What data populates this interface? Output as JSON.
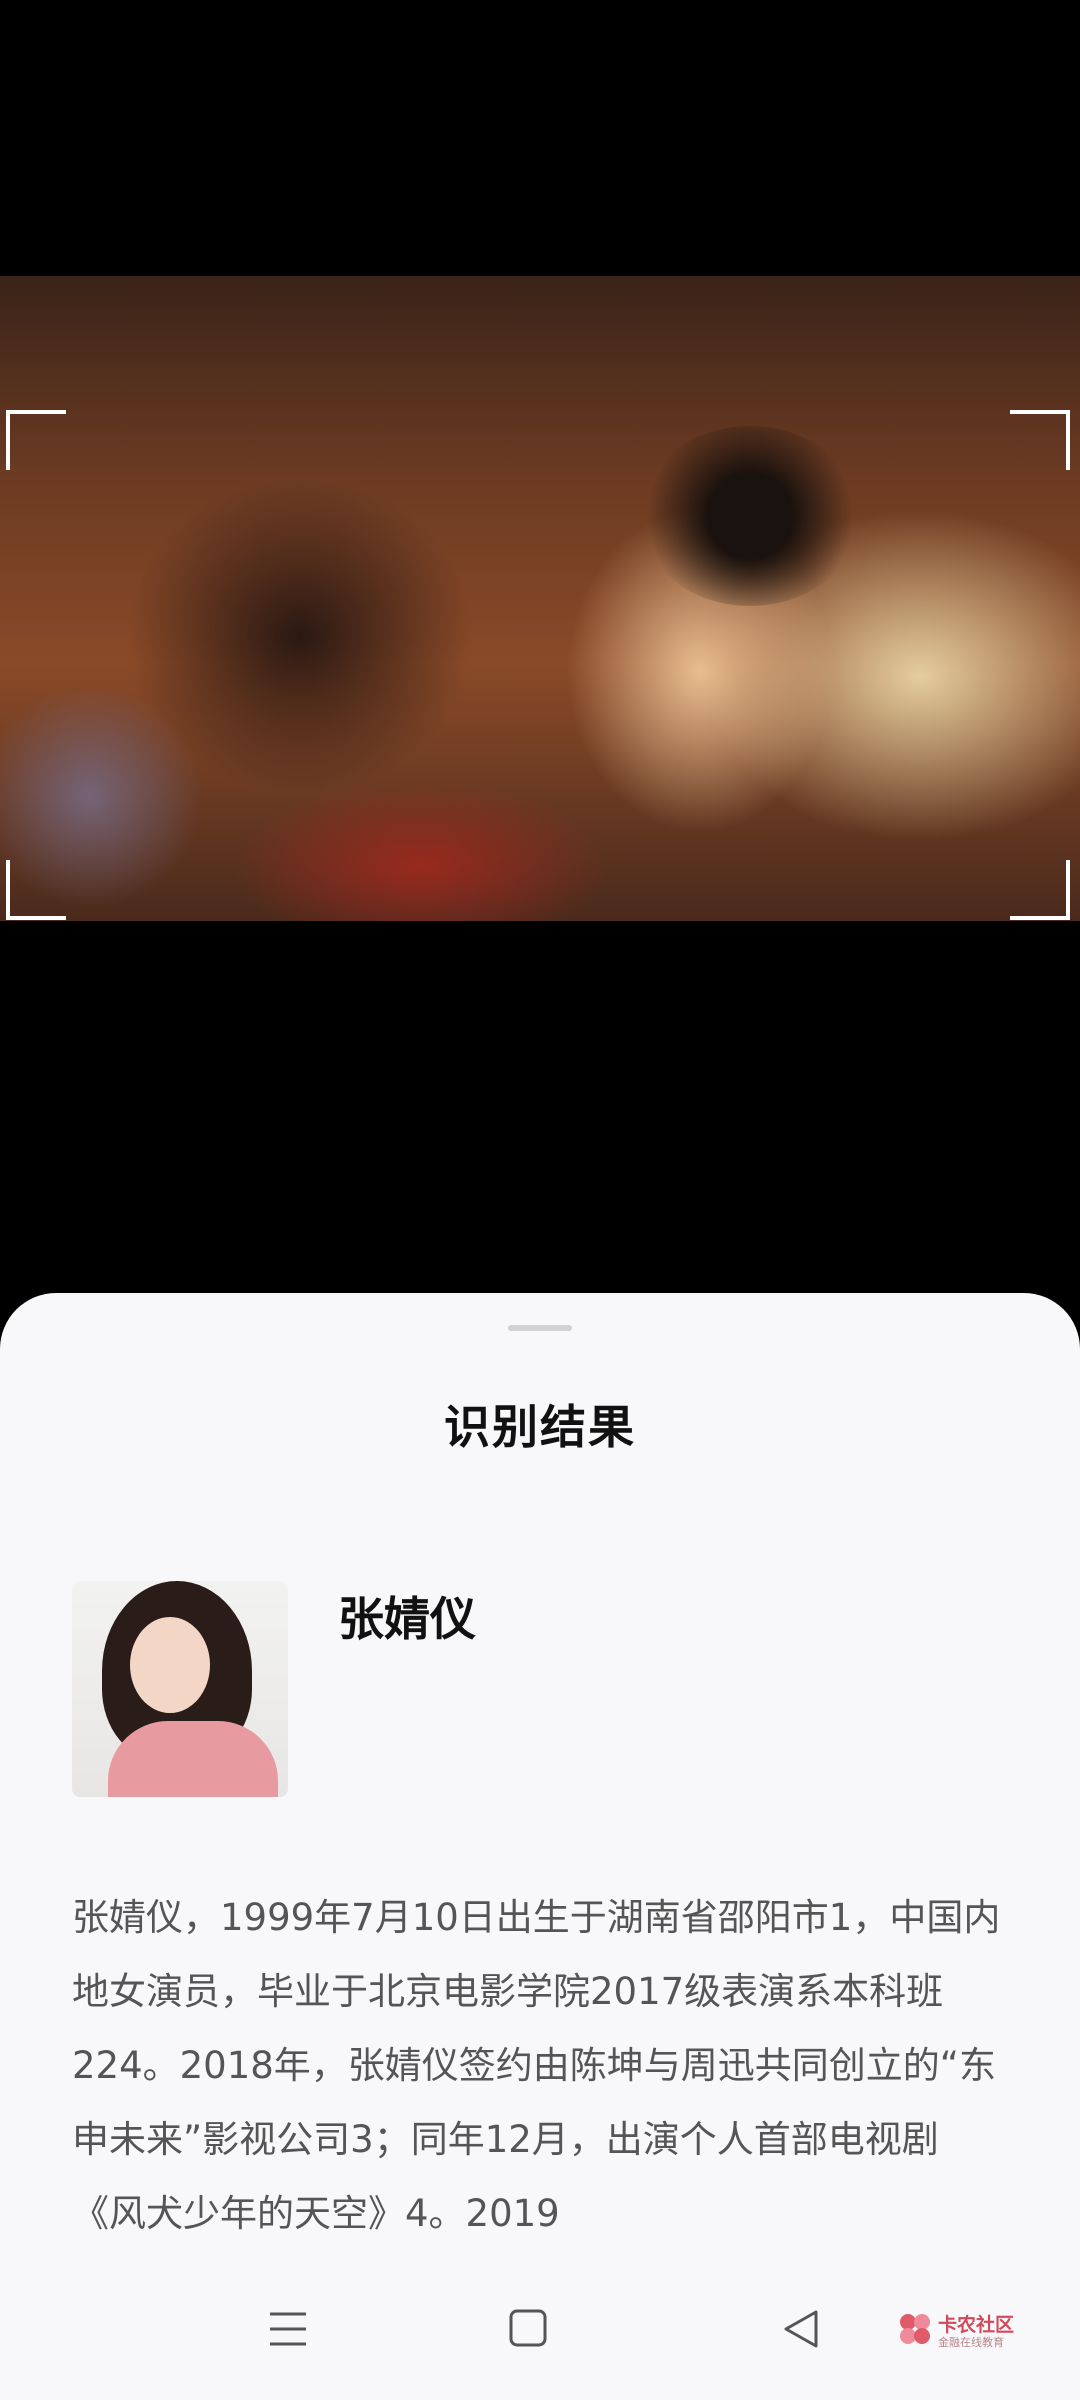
{
  "result_sheet": {
    "title": "识别结果",
    "person": {
      "name": "张婧仪",
      "description": "张婧仪，1999年7月10日出生于湖南省邵阳市1，中国内地女演员，毕业于北京电影学院2017级表演系本科班224。2018年，张婧仪签约由陈坤与周迅共同创立的“东申未来”影视公司3；同年12月，出演个人首部电视剧《风犬少年的天空》4。2019"
    }
  },
  "navigation_bar": {
    "buttons": [
      "menu-icon",
      "home-icon",
      "back-icon"
    ]
  },
  "watermark": {
    "title": "卡农社区",
    "subtitle": "金融在线教育"
  },
  "colors": {
    "sheet_background": "#f8f8fa",
    "screen_background": "#000000",
    "watermark_accent": "#d24a5a"
  }
}
